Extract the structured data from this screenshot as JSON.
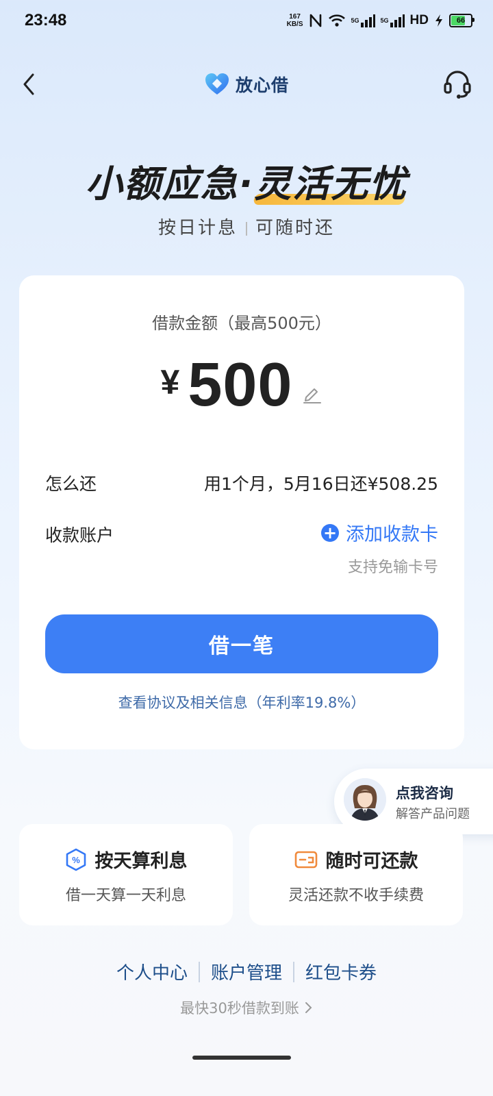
{
  "status_bar": {
    "time": "23:48",
    "net_speed_value": "167",
    "net_speed_unit": "KB/S",
    "signal1_label": "5G",
    "signal2_label": "5G",
    "hd_label": "HD",
    "battery": "66"
  },
  "nav": {
    "brand": "放心借",
    "back_icon": "chevron-left-icon",
    "support_icon": "headset-icon"
  },
  "hero": {
    "title_part1": "小额应急·",
    "title_part2": "灵活无忧",
    "sub_left": "按日计息",
    "sub_right": "可随时还"
  },
  "loan": {
    "label": "借款金额（最高500元）",
    "currency": "¥",
    "amount": "500",
    "repay_label": "怎么还",
    "repay_value": "用1个月，5月16日还¥508.25",
    "account_label": "收款账户",
    "add_card": "添加收款卡",
    "add_card_hint": "支持免输卡号",
    "borrow_button": "借一笔",
    "agreement": "查看协议及相关信息（年利率19.8%）"
  },
  "consult": {
    "title": "点我咨询",
    "subtitle": "解答产品问题"
  },
  "features": [
    {
      "title": "按天算利息",
      "desc": "借一天算一天利息",
      "icon": "percent-shield-icon"
    },
    {
      "title": "随时可还款",
      "desc": "灵活还款不收手续费",
      "icon": "wallet-icon"
    }
  ],
  "bottom": {
    "links": [
      "个人中心",
      "账户管理",
      "红包卡券"
    ],
    "note": "最快30秒借款到账"
  },
  "colors": {
    "primary": "#3d7ff5",
    "link": "#3478f6",
    "accent_orange": "#f08a3c"
  }
}
